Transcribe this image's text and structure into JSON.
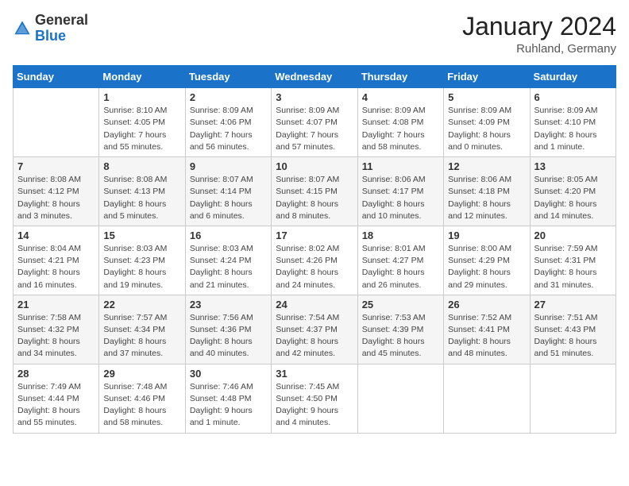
{
  "header": {
    "logo_general": "General",
    "logo_blue": "Blue",
    "title": "January 2024",
    "subtitle": "Ruhland, Germany"
  },
  "days_of_week": [
    "Sunday",
    "Monday",
    "Tuesday",
    "Wednesday",
    "Thursday",
    "Friday",
    "Saturday"
  ],
  "weeks": [
    [
      {
        "day": "",
        "info": ""
      },
      {
        "day": "1",
        "info": "Sunrise: 8:10 AM\nSunset: 4:05 PM\nDaylight: 7 hours\nand 55 minutes."
      },
      {
        "day": "2",
        "info": "Sunrise: 8:09 AM\nSunset: 4:06 PM\nDaylight: 7 hours\nand 56 minutes."
      },
      {
        "day": "3",
        "info": "Sunrise: 8:09 AM\nSunset: 4:07 PM\nDaylight: 7 hours\nand 57 minutes."
      },
      {
        "day": "4",
        "info": "Sunrise: 8:09 AM\nSunset: 4:08 PM\nDaylight: 7 hours\nand 58 minutes."
      },
      {
        "day": "5",
        "info": "Sunrise: 8:09 AM\nSunset: 4:09 PM\nDaylight: 8 hours\nand 0 minutes."
      },
      {
        "day": "6",
        "info": "Sunrise: 8:09 AM\nSunset: 4:10 PM\nDaylight: 8 hours\nand 1 minute."
      }
    ],
    [
      {
        "day": "7",
        "info": "Sunrise: 8:08 AM\nSunset: 4:12 PM\nDaylight: 8 hours\nand 3 minutes."
      },
      {
        "day": "8",
        "info": "Sunrise: 8:08 AM\nSunset: 4:13 PM\nDaylight: 8 hours\nand 5 minutes."
      },
      {
        "day": "9",
        "info": "Sunrise: 8:07 AM\nSunset: 4:14 PM\nDaylight: 8 hours\nand 6 minutes."
      },
      {
        "day": "10",
        "info": "Sunrise: 8:07 AM\nSunset: 4:15 PM\nDaylight: 8 hours\nand 8 minutes."
      },
      {
        "day": "11",
        "info": "Sunrise: 8:06 AM\nSunset: 4:17 PM\nDaylight: 8 hours\nand 10 minutes."
      },
      {
        "day": "12",
        "info": "Sunrise: 8:06 AM\nSunset: 4:18 PM\nDaylight: 8 hours\nand 12 minutes."
      },
      {
        "day": "13",
        "info": "Sunrise: 8:05 AM\nSunset: 4:20 PM\nDaylight: 8 hours\nand 14 minutes."
      }
    ],
    [
      {
        "day": "14",
        "info": "Sunrise: 8:04 AM\nSunset: 4:21 PM\nDaylight: 8 hours\nand 16 minutes."
      },
      {
        "day": "15",
        "info": "Sunrise: 8:03 AM\nSunset: 4:23 PM\nDaylight: 8 hours\nand 19 minutes."
      },
      {
        "day": "16",
        "info": "Sunrise: 8:03 AM\nSunset: 4:24 PM\nDaylight: 8 hours\nand 21 minutes."
      },
      {
        "day": "17",
        "info": "Sunrise: 8:02 AM\nSunset: 4:26 PM\nDaylight: 8 hours\nand 24 minutes."
      },
      {
        "day": "18",
        "info": "Sunrise: 8:01 AM\nSunset: 4:27 PM\nDaylight: 8 hours\nand 26 minutes."
      },
      {
        "day": "19",
        "info": "Sunrise: 8:00 AM\nSunset: 4:29 PM\nDaylight: 8 hours\nand 29 minutes."
      },
      {
        "day": "20",
        "info": "Sunrise: 7:59 AM\nSunset: 4:31 PM\nDaylight: 8 hours\nand 31 minutes."
      }
    ],
    [
      {
        "day": "21",
        "info": "Sunrise: 7:58 AM\nSunset: 4:32 PM\nDaylight: 8 hours\nand 34 minutes."
      },
      {
        "day": "22",
        "info": "Sunrise: 7:57 AM\nSunset: 4:34 PM\nDaylight: 8 hours\nand 37 minutes."
      },
      {
        "day": "23",
        "info": "Sunrise: 7:56 AM\nSunset: 4:36 PM\nDaylight: 8 hours\nand 40 minutes."
      },
      {
        "day": "24",
        "info": "Sunrise: 7:54 AM\nSunset: 4:37 PM\nDaylight: 8 hours\nand 42 minutes."
      },
      {
        "day": "25",
        "info": "Sunrise: 7:53 AM\nSunset: 4:39 PM\nDaylight: 8 hours\nand 45 minutes."
      },
      {
        "day": "26",
        "info": "Sunrise: 7:52 AM\nSunset: 4:41 PM\nDaylight: 8 hours\nand 48 minutes."
      },
      {
        "day": "27",
        "info": "Sunrise: 7:51 AM\nSunset: 4:43 PM\nDaylight: 8 hours\nand 51 minutes."
      }
    ],
    [
      {
        "day": "28",
        "info": "Sunrise: 7:49 AM\nSunset: 4:44 PM\nDaylight: 8 hours\nand 55 minutes."
      },
      {
        "day": "29",
        "info": "Sunrise: 7:48 AM\nSunset: 4:46 PM\nDaylight: 8 hours\nand 58 minutes."
      },
      {
        "day": "30",
        "info": "Sunrise: 7:46 AM\nSunset: 4:48 PM\nDaylight: 9 hours\nand 1 minute."
      },
      {
        "day": "31",
        "info": "Sunrise: 7:45 AM\nSunset: 4:50 PM\nDaylight: 9 hours\nand 4 minutes."
      },
      {
        "day": "",
        "info": ""
      },
      {
        "day": "",
        "info": ""
      },
      {
        "day": "",
        "info": ""
      }
    ]
  ]
}
